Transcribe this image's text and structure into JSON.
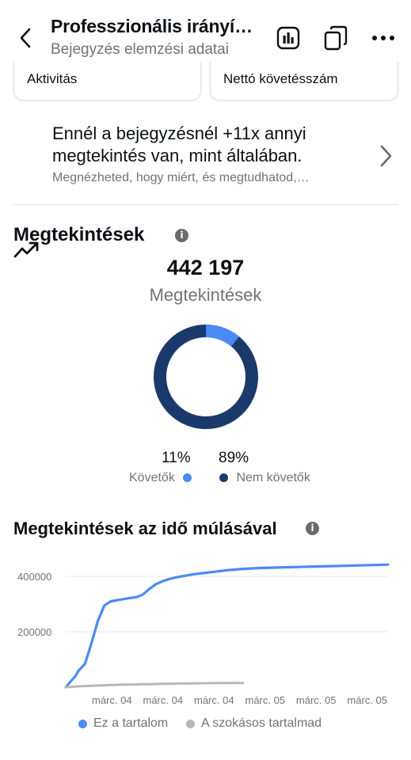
{
  "header": {
    "title": "Professzionális irányí…",
    "subtitle": "Bejegyzés elemzési adatai"
  },
  "cards": [
    {
      "label": "Aktivitás"
    },
    {
      "label": "Nettó követésszám"
    }
  ],
  "insight": {
    "title": "Ennél a bejegyzésnél +11x annyi megtekintés van, mint általában.",
    "subtitle": "Megnézheted, hogy miért, és megtudhatod,…"
  },
  "views": {
    "title": "Megtekintések",
    "total": "442 197",
    "total_label": "Megtekintések",
    "followers_pct": "11%",
    "followers_label": "Követők",
    "non_followers_pct": "89%",
    "non_followers_label": "Nem követők",
    "followers_color": "#4a8af4",
    "non_followers_color": "#1a3a6b"
  },
  "views_over_time": {
    "title": "Megtekintések az idő múlásával",
    "legend_this": "Ez a tartalom",
    "legend_usual": "A szokásos tartalmad"
  },
  "chart_data": [
    {
      "type": "pie",
      "labels": [
        "Követők",
        "Nem követők"
      ],
      "values": [
        11,
        89
      ],
      "colors": [
        "#4a8af4",
        "#1a3a6b"
      ]
    },
    {
      "type": "line",
      "x": [
        0,
        0.03,
        0.04,
        0.06,
        0.08,
        0.1,
        0.12,
        0.14,
        0.18,
        0.2,
        0.22,
        0.24,
        0.26,
        0.28,
        0.3,
        0.32,
        0.35,
        0.38,
        0.4,
        0.45,
        0.5,
        0.55,
        0.6,
        0.7,
        0.8,
        0.9,
        1.0
      ],
      "x_ticks": [
        "márc. 04",
        "márc. 04",
        "márc. 04",
        "márc. 05",
        "márc. 05",
        "márc. 05"
      ],
      "y_ticks": [
        "400000",
        "200000"
      ],
      "ylim": [
        0,
        440000
      ],
      "grid": true,
      "series": [
        {
          "name": "Ez a tartalom",
          "color": "#4a8af4",
          "values": [
            0,
            40000,
            60000,
            85000,
            160000,
            240000,
            295000,
            310000,
            318000,
            322000,
            325000,
            335000,
            355000,
            372000,
            382000,
            390000,
            398000,
            404000,
            408000,
            415000,
            422000,
            427000,
            430000,
            433000,
            436000,
            439000,
            442197
          ]
        },
        {
          "name": "A szokásos tartalmad",
          "color": "#b8b8b8",
          "values": [
            0,
            2000,
            3000,
            4000,
            5000,
            6000,
            7000,
            8000,
            9000,
            9500,
            10000,
            10500,
            11000,
            11500,
            12000,
            12500,
            13000,
            13500,
            14000,
            14500,
            15000,
            15500,
            null,
            null,
            null,
            null,
            null
          ]
        }
      ]
    }
  ]
}
